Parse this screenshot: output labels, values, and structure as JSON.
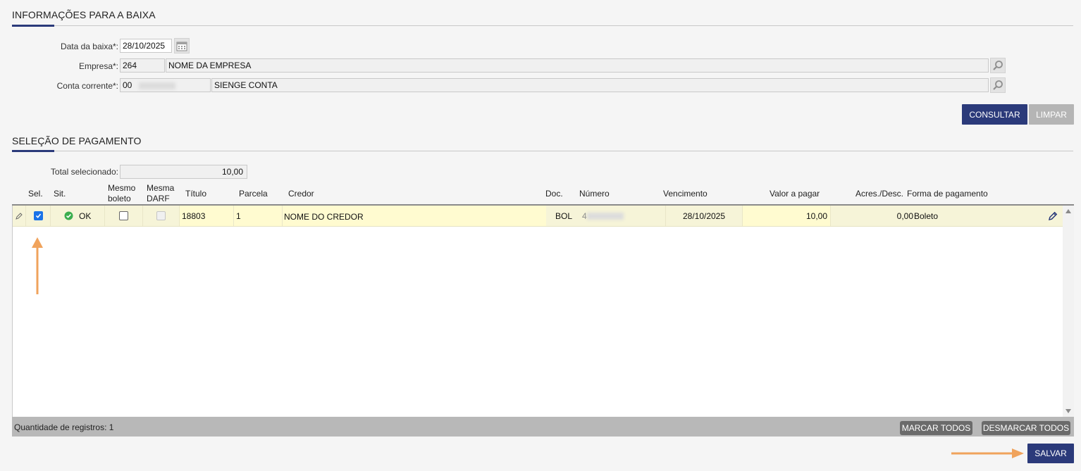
{
  "section_info": {
    "title": "INFORMAÇÕES PARA A BAIXA"
  },
  "form": {
    "date_label": "Data da baixa*:",
    "date_value": "28/10/2025",
    "company_label": "Empresa*:",
    "company_code": "264",
    "company_name": "NOME DA EMPRESA",
    "account_label": "Conta corrente*:",
    "account_code": "00",
    "account_name": "SIENGE CONTA"
  },
  "actions": {
    "consultar": "CONSULTAR",
    "limpar": "LIMPAR"
  },
  "section_payment": {
    "title": "SELEÇÃO DE PAGAMENTO"
  },
  "total": {
    "label": "Total selecionado:",
    "value": "10,00"
  },
  "grid": {
    "headers": {
      "sel": "Sel.",
      "sit": "Sit.",
      "mesmo_boleto_1": "Mesmo",
      "mesmo_boleto_2": "boleto",
      "mesma_darf_1": "Mesma",
      "mesma_darf_2": "DARF",
      "titulo": "Título",
      "parcela": "Parcela",
      "credor": "Credor",
      "doc": "Doc.",
      "numero": "Número",
      "vencimento": "Vencimento",
      "valor": "Valor a pagar",
      "acres": "Acres./Desc.",
      "forma": "Forma de pagamento"
    },
    "rows": [
      {
        "sel_checked": true,
        "status": "OK",
        "titulo": "18803",
        "parcela": "1",
        "credor": "NOME DO CREDOR",
        "doc": "BOL",
        "numero_prefix": "4",
        "vencimento": "28/10/2025",
        "valor": "10,00",
        "acres": "0,00",
        "forma": "Boleto"
      }
    ],
    "footer": {
      "count_label": "Quantidade de registros:",
      "count_value": "1",
      "marcar": "MARCAR TODOS",
      "desmarcar": "DESMARCAR TODOS"
    }
  },
  "save": {
    "label": "SALVAR"
  },
  "colors": {
    "primary": "#2b3a7a",
    "annotation_arrow": "#f0a35c",
    "ok_green": "#3cae4f",
    "checkbox_blue": "#1a73e8"
  }
}
